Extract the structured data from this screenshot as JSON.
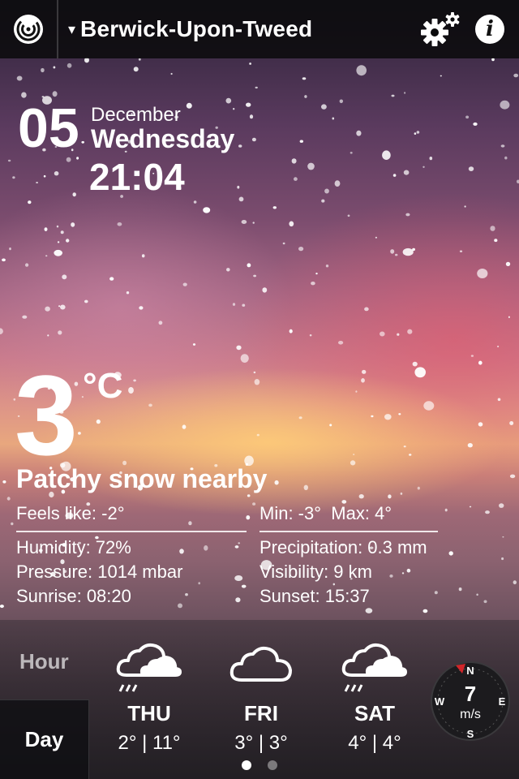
{
  "header": {
    "city": "Berwick-Upon-Tweed",
    "caret": "▾",
    "logo_icon": "app-logo-icon",
    "settings_icon": "gear-icon",
    "info_icon": "info-icon",
    "info_glyph": "i"
  },
  "date": {
    "day": "05",
    "month": "December",
    "weekday": "Wednesday",
    "time": "21:04"
  },
  "current": {
    "temperature": "3",
    "unit": "°C",
    "condition": "Patchy snow nearby",
    "feels_like": "Feels like: -2°",
    "min_max": "Min: -3°  Max: 4°",
    "humidity": "Humidity: 72%",
    "precipitation": "Precipitation: 0.3 mm",
    "pressure": "Pressure: 1014 mbar",
    "visibility": "Visibility: 9 km",
    "sunrise": "Sunrise: 08:20",
    "sunset": "Sunset: 15:37"
  },
  "tabs": {
    "hour": "Hour",
    "day": "Day",
    "active": "Day"
  },
  "forecast": [
    {
      "day": "THU",
      "range": "2° | 11°",
      "icon": "cloud-snow-icon"
    },
    {
      "day": "FRI",
      "range": "3° | 3°",
      "icon": "cloud-icon"
    },
    {
      "day": "SAT",
      "range": "4° | 4°",
      "icon": "cloud-snow-icon"
    }
  ],
  "pager": {
    "pages": 2,
    "current": 1
  },
  "wind": {
    "speed": "7",
    "unit": "m/s",
    "direction_labels": {
      "n": "N",
      "e": "E",
      "s": "S",
      "w": "W"
    },
    "pointer_color": "#d0262a"
  }
}
